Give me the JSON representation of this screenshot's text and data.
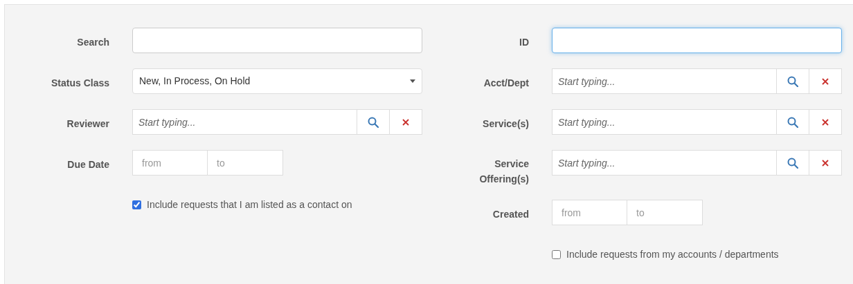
{
  "columns": [
    {
      "fields": [
        {
          "kind": "text",
          "label": "Search",
          "focused": false
        },
        {
          "kind": "select",
          "label": "Status Class",
          "value": "New, In Process, On Hold"
        },
        {
          "kind": "lookup",
          "label": "Reviewer",
          "placeholder": "Start typing..."
        },
        {
          "kind": "daterange",
          "label": "Due Date",
          "from_placeholder": "from",
          "to_placeholder": "to"
        },
        {
          "kind": "checkbox",
          "label": "Include requests that I am listed as a contact on",
          "checked": true
        }
      ]
    },
    {
      "fields": [
        {
          "kind": "text",
          "label": "ID",
          "focused": true
        },
        {
          "kind": "lookup",
          "label": "Acct/Dept",
          "placeholder": "Start typing..."
        },
        {
          "kind": "lookup",
          "label": "Service(s)",
          "placeholder": "Start typing..."
        },
        {
          "kind": "lookup",
          "label": "Service Offering(s)",
          "placeholder": "Start typing..."
        },
        {
          "kind": "daterange",
          "label": "Created",
          "from_placeholder": "from",
          "to_placeholder": "to"
        },
        {
          "kind": "checkbox",
          "label": "Include requests from my accounts / departments",
          "checked": false
        }
      ]
    }
  ]
}
